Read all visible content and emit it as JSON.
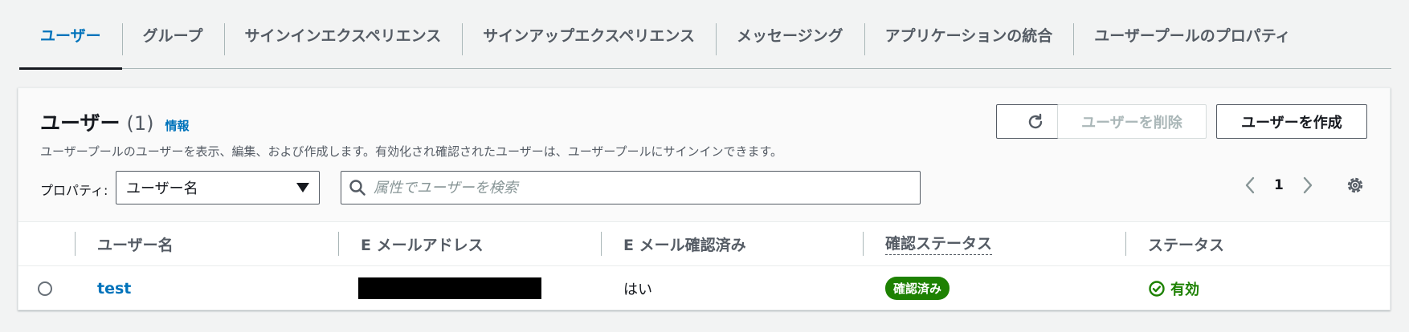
{
  "tabs": [
    {
      "label": "ユーザー",
      "active": true
    },
    {
      "label": "グループ",
      "active": false
    },
    {
      "label": "サインインエクスペリエンス",
      "active": false
    },
    {
      "label": "サインアップエクスペリエンス",
      "active": false
    },
    {
      "label": "メッセージング",
      "active": false
    },
    {
      "label": "アプリケーションの統合",
      "active": false
    },
    {
      "label": "ユーザープールのプロパティ",
      "active": false
    }
  ],
  "panel": {
    "title": "ユーザー",
    "count": "(1)",
    "info": "情報",
    "description": "ユーザープールのユーザーを表示、編集、および作成します。有効化され確認されたユーザーは、ユーザープールにサインインできます。",
    "delete_label": "ユーザーを削除",
    "create_label": "ユーザーを作成",
    "property_label": "プロパティ:",
    "property_value": "ユーザー名",
    "search_placeholder": "属性でユーザーを検索",
    "page": "1"
  },
  "table": {
    "headers": [
      "ユーザー名",
      "E メールアドレス",
      "E メール確認済み",
      "確認ステータス",
      "ステータス"
    ],
    "rows": [
      {
        "username": "test",
        "email": "",
        "email_verified": "はい",
        "confirmation": "確認済み",
        "status": "有効"
      }
    ]
  },
  "colors": {
    "accent": "#0073bb",
    "success": "#1d8102",
    "text": "#16191f"
  }
}
